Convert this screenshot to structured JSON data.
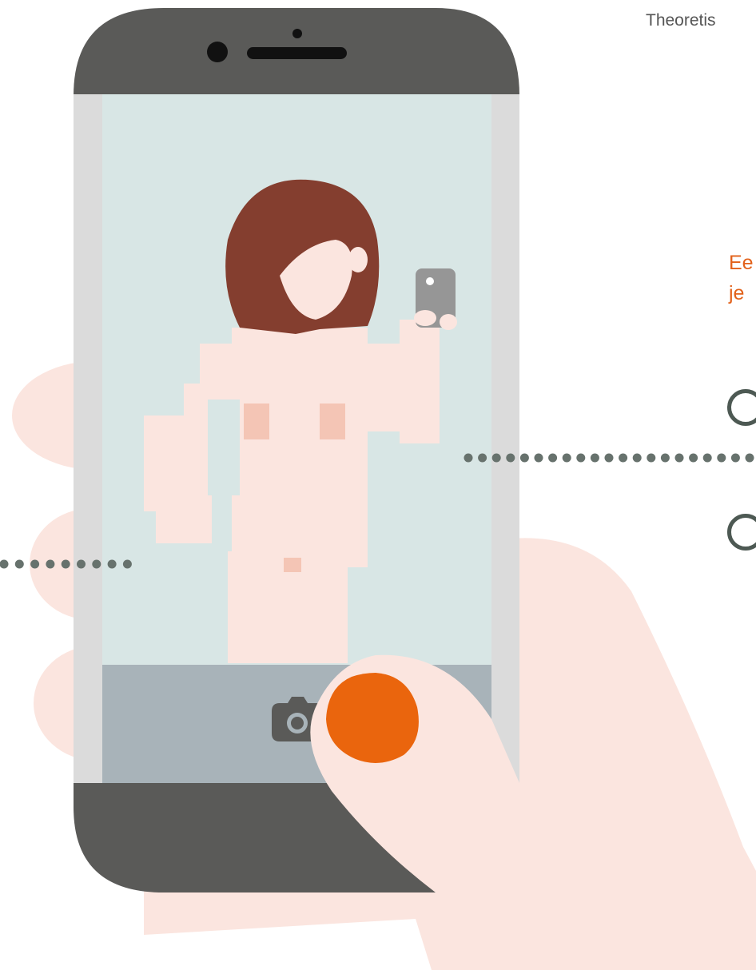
{
  "header": {
    "text": "Theoretis"
  },
  "question": {
    "line1": "Ee",
    "line2": "je"
  },
  "options": [
    {
      "state": "unchecked"
    },
    {
      "state": "unchecked"
    }
  ],
  "phone": {
    "camera_button_icon": "camera-icon"
  },
  "colors": {
    "skin": "#fbe5df",
    "phone_body": "#5a5a58",
    "screen": "#d8e6e5",
    "bottom_bar": "#a8b3b9",
    "hair": "#843e2f",
    "accent_orange": "#ea650d",
    "dots": "#67726d"
  }
}
